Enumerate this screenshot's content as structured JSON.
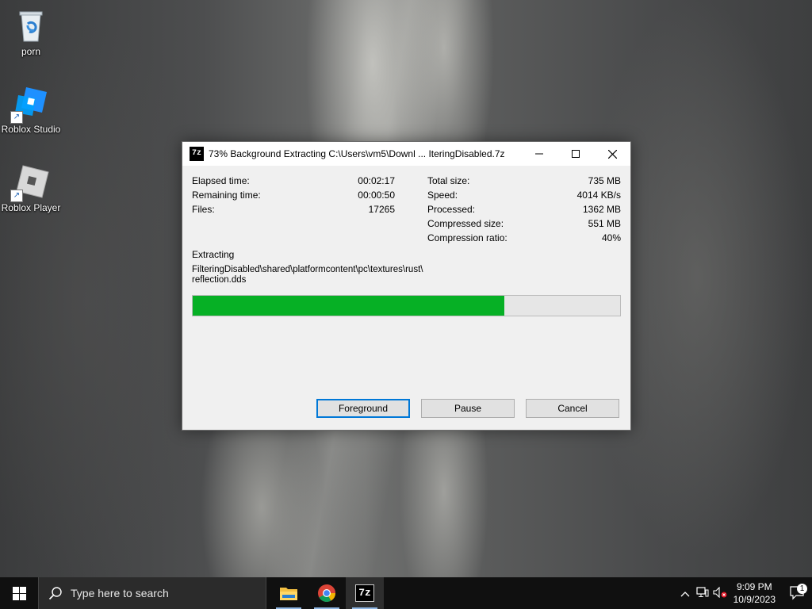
{
  "desktop": {
    "icons": [
      {
        "label": "porn"
      },
      {
        "label": "Roblox Studio"
      },
      {
        "label": "Roblox Player"
      }
    ]
  },
  "dialog": {
    "app_icon_text": "7z",
    "title": "73% Background Extracting C:\\Users\\vm5\\Downl ... IteringDisabled.7z",
    "stats_left": [
      {
        "label": "Elapsed time:",
        "value": "00:02:17"
      },
      {
        "label": "Remaining time:",
        "value": "00:00:50"
      },
      {
        "label": "Files:",
        "value": "17265"
      }
    ],
    "stats_right": [
      {
        "label": "Total size:",
        "value": "735 MB"
      },
      {
        "label": "Speed:",
        "value": "4014 KB/s"
      },
      {
        "label": "Processed:",
        "value": "1362 MB"
      },
      {
        "label": "Compressed size:",
        "value": "551 MB"
      },
      {
        "label": "Compression ratio:",
        "value": "40%"
      }
    ],
    "action": "Extracting",
    "current_file_line1": "FilteringDisabled\\shared\\platformcontent\\pc\\textures\\rust\\",
    "current_file_line2": "reflection.dds",
    "progress_percent": 73,
    "progress_color": "#06b025",
    "buttons": {
      "foreground": "Foreground",
      "pause": "Pause",
      "cancel": "Cancel"
    }
  },
  "taskbar": {
    "search_placeholder": "Type here to search",
    "apps": [
      "file-explorer-icon",
      "chrome-icon",
      "7zip-icon"
    ],
    "tray": {
      "time": "9:09 PM",
      "date": "10/9/2023",
      "notification_count": "1"
    }
  }
}
